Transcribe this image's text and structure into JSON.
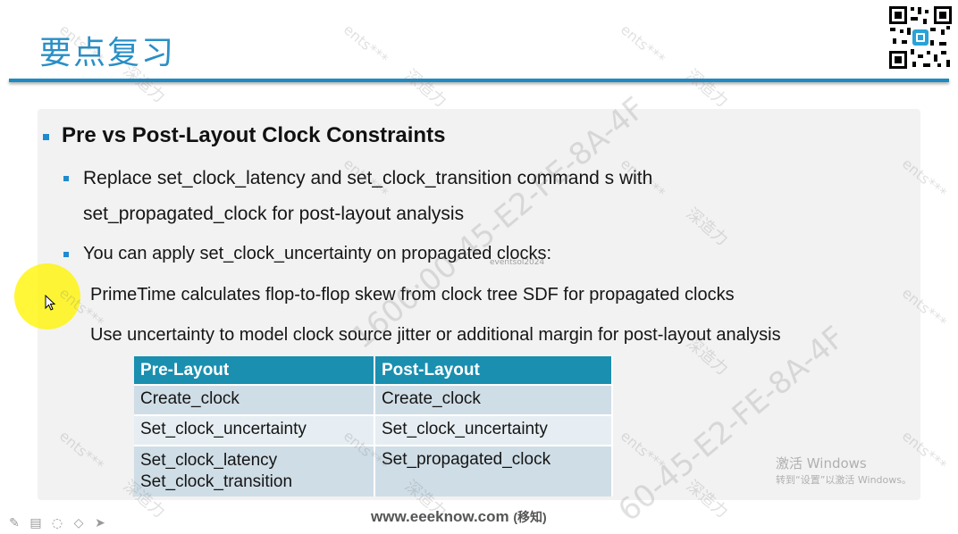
{
  "slide": {
    "title": "要点复习"
  },
  "content": {
    "heading": "Pre vs Post-Layout Clock Constraints",
    "bullets": [
      {
        "line1": "Replace  set_clock_latency and  set_clock_transition command s with",
        "line2": "set_propagated_clock for post-layout analysis"
      },
      {
        "line1": "You can apply set_clock_uncertainty on propagated clocks:"
      }
    ],
    "sub_bullets": [
      "PrimeTime calculates flop-to-flop skew from clock tree SDF for propagated clocks",
      "Use uncertainty to model clock source jitter or additional margin for post-layout analysis"
    ]
  },
  "table": {
    "headers": [
      "Pre-Layout",
      "Post-Layout"
    ],
    "rows": [
      [
        "Create_clock",
        "Create_clock"
      ],
      [
        "Set_clock_uncertainty",
        "Set_clock_uncertainty"
      ],
      [
        "Set_clock_latency\nSet_clock_transition",
        "Set_propagated_clock"
      ]
    ]
  },
  "overlay": {
    "ghost_text": "eventsol2024",
    "windows_activation_title": "激活 Windows",
    "windows_activation_sub": "转到“设置”以激活 Windows。"
  },
  "footer": {
    "site": "www.eeeknow.com",
    "suffix": "(移知)"
  },
  "watermarks": {
    "a": "ents***",
    "b": "深造力",
    "c": "1600:00-45-E2-FE-8A-4F",
    "d": "60-45-E2-FE-8A-4F"
  },
  "toolbar": {
    "icons": [
      "pen-icon",
      "slides-icon",
      "eraser-icon",
      "pointer-icon",
      "arrow-icon"
    ]
  }
}
